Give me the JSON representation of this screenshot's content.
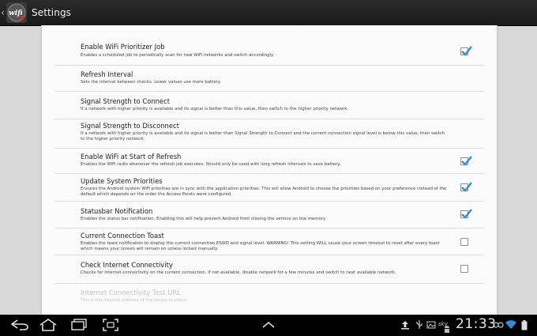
{
  "app": {
    "title": "Settings",
    "logo_text": "wifi",
    "icon": "wifi-prioritizer-app-icon"
  },
  "preferences": [
    {
      "id": "enable-job",
      "title": "Enable WiFi Prioritizer Job",
      "summary": "Enables a scheduled job to periodically scan for new WiFi networks and switch accordingly.",
      "checkbox": true,
      "checked": true
    },
    {
      "id": "refresh-interval",
      "title": "Refresh Interval",
      "summary": "Sets the interval between checks. Lower values use more battery.",
      "checkbox": false
    },
    {
      "id": "signal-connect",
      "title": "Signal Strength to Connect",
      "summary": "If a network with higher priority is available and its signal is better than this value, then switch to the higher priority network.",
      "checkbox": false
    },
    {
      "id": "signal-disconnect",
      "title": "Signal Strength to Disconnect",
      "summary": "If a network with higher priority is available and its signal is better than Signal Strength to Connect and the current connection signal level is below this value, then switch to the higher priority network.",
      "checkbox": false
    },
    {
      "id": "enable-wifi-refresh",
      "title": "Enable WiFi at Start of Refresh",
      "summary": "Enables the WiFi radio whenever the refresh job executes. Should only be used with long refresh intervals to save battery.",
      "checkbox": true,
      "checked": true
    },
    {
      "id": "update-priorities",
      "title": "Update System Priorities",
      "summary": "Ensures the Android system WiFi priorities are in sync with the application priorities. This will allow Android to choose the priorities based on your preference instead of the default which depends on the order the Access Points were configured.",
      "checkbox": true,
      "checked": true
    },
    {
      "id": "statusbar-notification",
      "title": "Statusbar Notification",
      "summary": "Enables the status bar notification. Enabling this will help prevent Android from closing the service on low memory.",
      "checkbox": true,
      "checked": true
    },
    {
      "id": "connection-toast",
      "title": "Current Connection Toast",
      "summary": "Enables the toast notification to display the current connection ESSID and signal level. WARNING! This setting WILL cause your screen timeout to reset after every toast which means your screen will remain on unless locked manually.",
      "checkbox": true,
      "checked": false
    },
    {
      "id": "check-internet",
      "title": "Check Internet Connectivity",
      "summary": "Checks for internet connectivity on the current connection. If not available, disable network for a few minutes and switch to next available network.",
      "checkbox": true,
      "checked": false
    },
    {
      "id": "test-url",
      "title": "Internet Connectivity Test URL",
      "summary": "This is the internet address of the server to check.",
      "checkbox": false,
      "disabled": true
    }
  ],
  "system_bar": {
    "clock": "21:33",
    "nav_icons": [
      "back-icon",
      "home-icon",
      "recent-apps-icon",
      "screenshot-icon",
      "expand-up-icon"
    ],
    "status_icons": [
      "upload-icon",
      "usb-icon",
      "image-icon",
      "sky-icon",
      "android-debug-icon",
      "usb-connected-icon",
      "wifi-signal-icon",
      "battery-icon"
    ],
    "status_small_text": "sky"
  },
  "colors": {
    "action_bar": "#1a1a1a",
    "panel": "#fbfbfb",
    "background": "#d9d9d9",
    "checkbox_check": "#2f8fd8",
    "wifi_signal": "#2f8fd8"
  }
}
